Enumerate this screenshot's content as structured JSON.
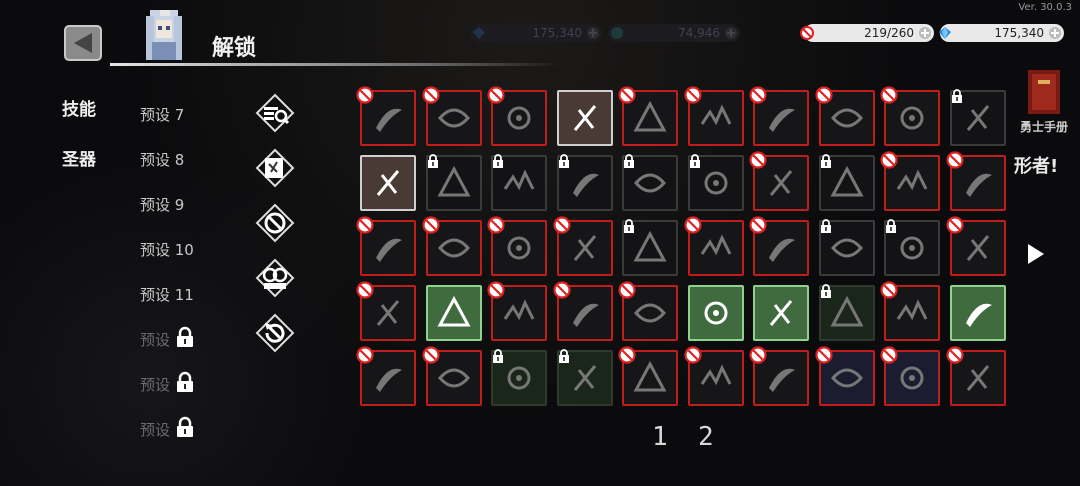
{
  "version": "Ver. 30.0.3",
  "header": {
    "title": "解锁"
  },
  "resources": [
    {
      "value": "175,340",
      "icon": "blue-gem-icon",
      "style": "dim"
    },
    {
      "value": "74,946",
      "icon": "teal-coin-icon",
      "style": "dim"
    },
    {
      "value": "219/260",
      "icon": "ban-icon",
      "style": "bright"
    },
    {
      "value": "175,340",
      "icon": "diamond-icon",
      "style": "bright"
    }
  ],
  "tabs": [
    {
      "label": "技能"
    },
    {
      "label": "圣器"
    }
  ],
  "presets": [
    {
      "label": "预设 7",
      "locked": false
    },
    {
      "label": "预设 8",
      "locked": false
    },
    {
      "label": "预设 9",
      "locked": false
    },
    {
      "label": "预设 10",
      "locked": false
    },
    {
      "label": "预设 11",
      "locked": false
    },
    {
      "label": "预设",
      "locked": true
    },
    {
      "label": "预设",
      "locked": true
    },
    {
      "label": "预设",
      "locked": true
    }
  ],
  "tools": [
    "search-list-icon",
    "skill-scroll-icon",
    "ban-filter-icon",
    "auto-icon",
    "reset-ban-icon"
  ],
  "skill_grid": {
    "rows": 5,
    "cols": 10,
    "cells": [
      [
        "banned",
        "banned",
        "banned",
        "selected",
        "banned",
        "banned",
        "banned",
        "banned",
        "banned",
        "locked"
      ],
      [
        "selected",
        "locked",
        "locked",
        "locked",
        "locked",
        "locked",
        "banned",
        "locked",
        "banned",
        "banned"
      ],
      [
        "banned",
        "banned",
        "banned",
        "banned",
        "locked",
        "banned",
        "banned",
        "locked",
        "locked",
        "banned"
      ],
      [
        "banned",
        "green",
        "banned",
        "banned",
        "banned",
        "green",
        "green",
        "lockgreen",
        "banned",
        "green"
      ],
      [
        "banned",
        "banned",
        "lockgreen",
        "lockgreen",
        "banned",
        "banned",
        "banned",
        "blue",
        "blue",
        "banned"
      ]
    ]
  },
  "pagination": {
    "pages": [
      "1",
      "2"
    ]
  },
  "right_side": {
    "book_label": "勇士手册",
    "banner_text": "形者!"
  },
  "colors": {
    "ban_red": "#c01d1d",
    "unlocked_green": "#8fd28f",
    "selected_border": "#cfcfcf"
  }
}
